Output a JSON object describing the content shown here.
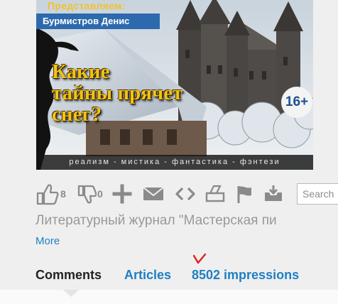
{
  "cover": {
    "presents": "Представляем:",
    "author": "Бурмистров Денис",
    "title_lines": [
      "Какие",
      "тайны прячет",
      "снег?"
    ],
    "age_rating": "16+",
    "genres": "реализм - мистика - фантастика - фэнтези"
  },
  "toolbar": {
    "like_count": "8",
    "dislike_count": "0",
    "search_placeholder": "Search"
  },
  "journal_title": "Литературный журнал \"Мастерская пи",
  "more_label": "More",
  "tabs": {
    "comments": "Comments",
    "articles": "Articles",
    "impressions": "8502 impressions"
  },
  "colors": {
    "link": "#1f7fc3",
    "icon": "#8a8a8a",
    "cover_title": "#f2c317",
    "author_band": "#2d6aad",
    "mark": "#e02020"
  }
}
